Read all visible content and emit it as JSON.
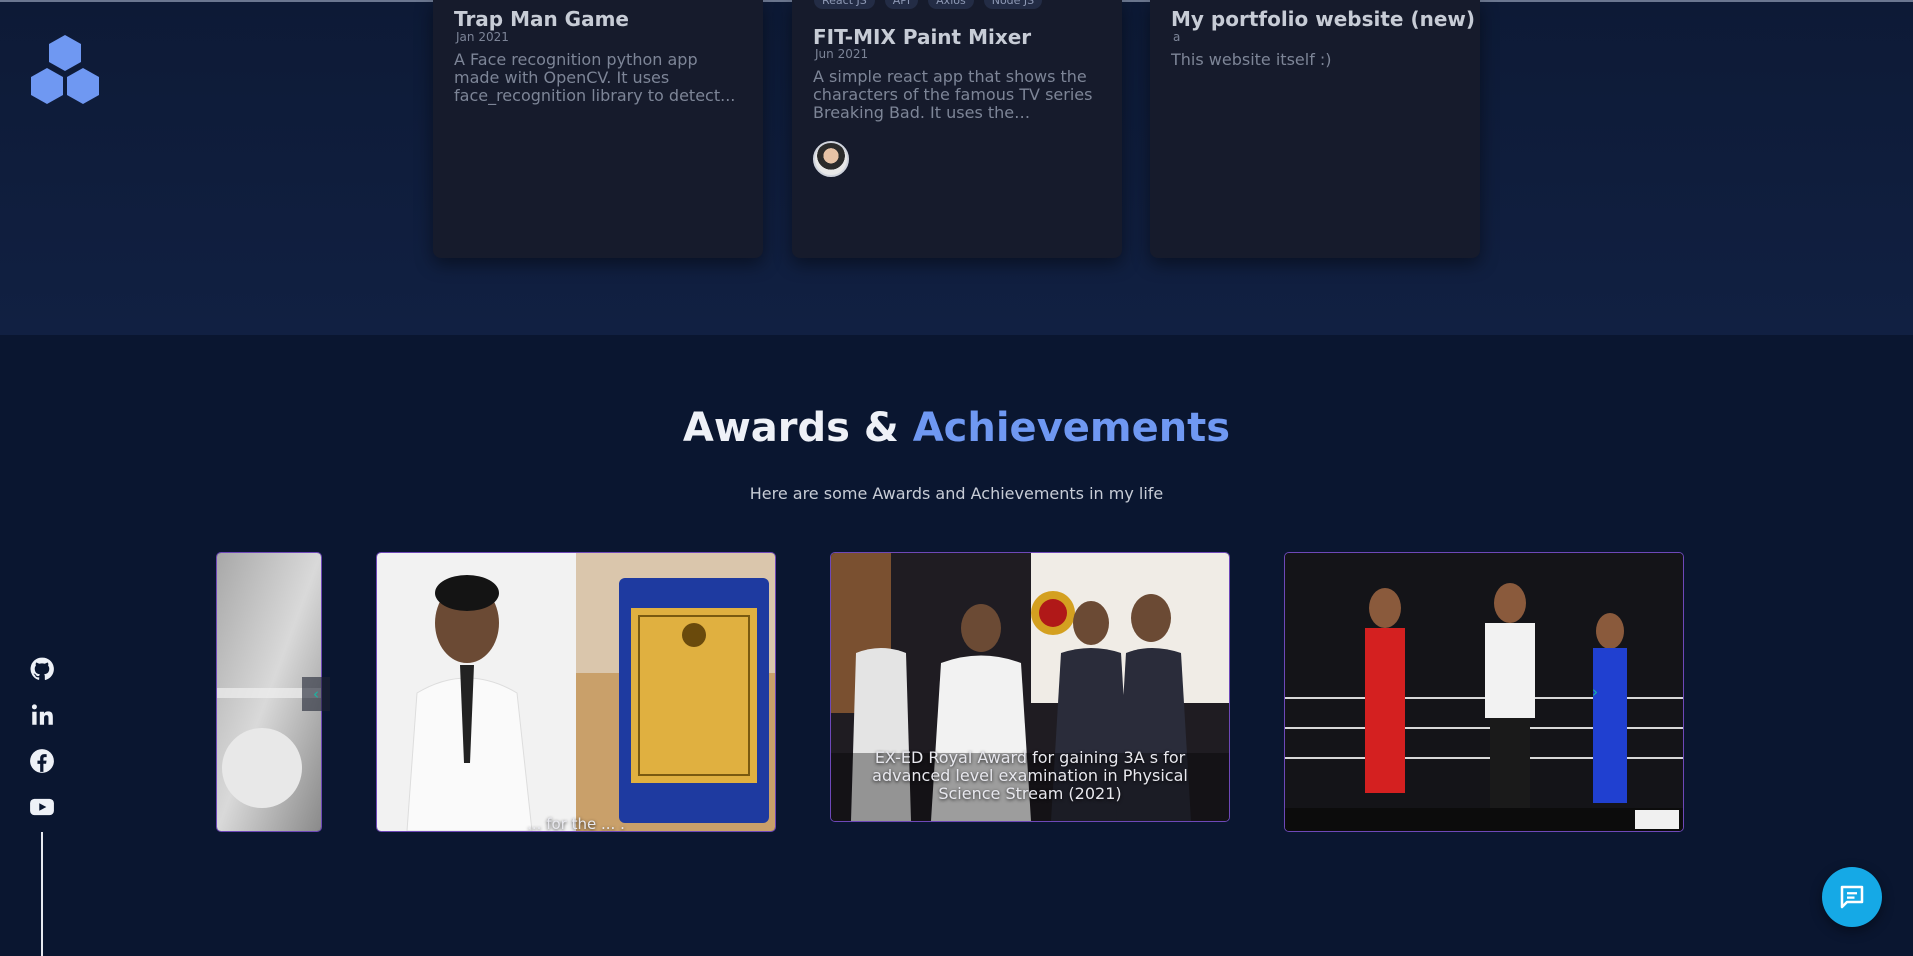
{
  "projects": [
    {
      "title": "Trap Man Game",
      "date": "Jan 2021",
      "description": "A Face recognition python app made with OpenCV. It uses face_recognition library to detect..."
    },
    {
      "title": "FIT-MIX Paint Mixer",
      "date": "Jun 2021",
      "tags": [
        "React JS",
        "API",
        "Axios",
        "Node JS"
      ],
      "description": "A simple react app that shows the characters of the famous TV series Breaking Bad. It uses the Breaking..."
    },
    {
      "title": "My portfolio website (new)",
      "date": "a",
      "description": "This website itself :)"
    }
  ],
  "awards": {
    "title_part1": "Awards &",
    "title_accent": "Achievements",
    "subtitle": "Here are some Awards and Achievements in my life",
    "cards": [
      {
        "caption": ""
      },
      {
        "caption": "... for the ... ."
      },
      {
        "caption": "EX-ED Royal Award for gaining 3A s for advanced level examination in Physical Science Stream (2021)"
      },
      {
        "caption": ""
      }
    ],
    "prev_icon": "chevron-left-icon",
    "next_icon": "chevron-right-icon"
  },
  "social_links": [
    {
      "name": "github-icon"
    },
    {
      "name": "linkedin-icon"
    },
    {
      "name": "facebook-icon"
    },
    {
      "name": "youtube-icon"
    }
  ],
  "colors": {
    "accent": "#6f98f2",
    "chat": "#15a9e6",
    "card_border": "#6e48b8",
    "arrow": "#15b8a4"
  }
}
